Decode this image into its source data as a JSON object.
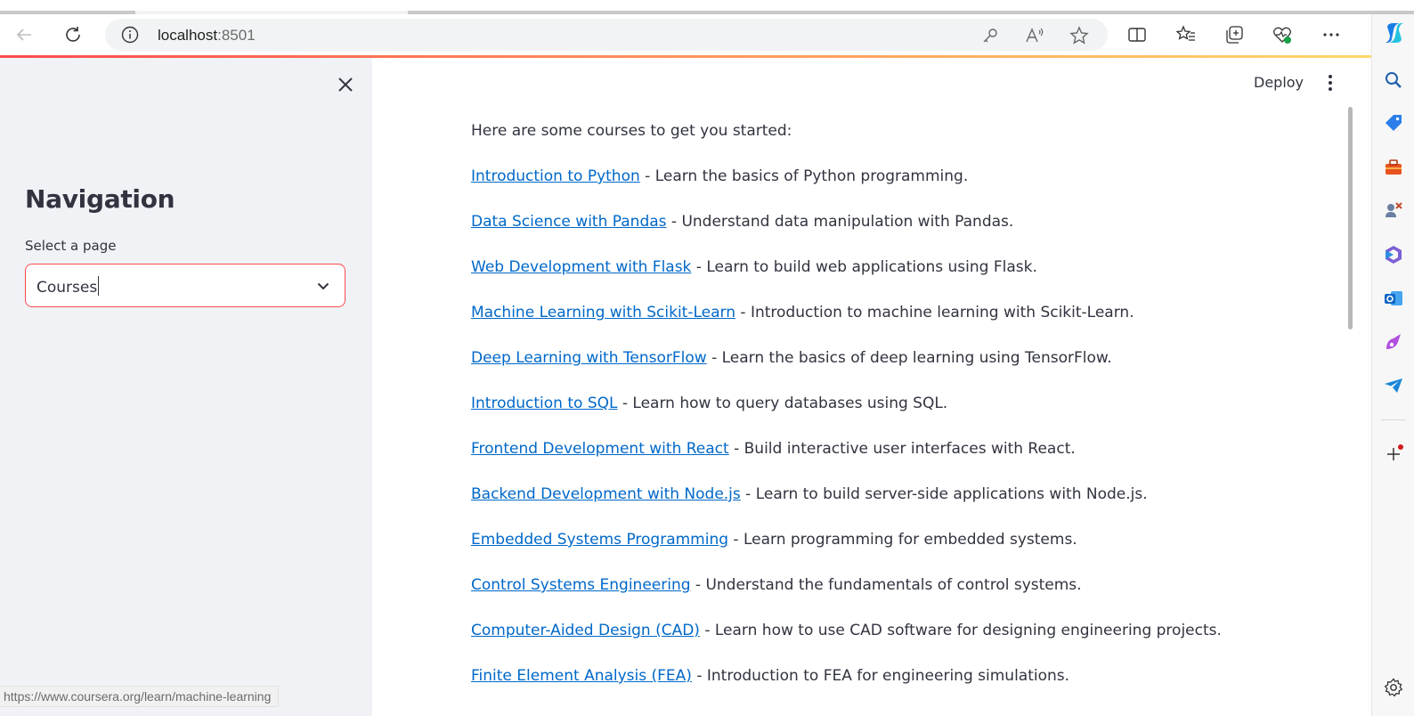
{
  "browser": {
    "url_host": "localhost",
    "url_port": ":8501",
    "status_url": "https://www.coursera.org/learn/machine-learning",
    "icons": [
      "back-icon",
      "refresh-icon",
      "info-icon",
      "key-icon",
      "read-aloud-icon",
      "favorite-star-icon",
      "split-screen-icon",
      "favorites-icon",
      "collections-icon",
      "browser-essentials-icon",
      "more-icon",
      "copilot-icon"
    ],
    "edge_icons": [
      "search-icon",
      "shopping-tag-icon",
      "tools-icon",
      "games-icon",
      "microsoft365-icon",
      "outlook-icon",
      "designer-icon",
      "telegram-icon",
      "add-icon",
      "settings-icon"
    ]
  },
  "app": {
    "header": {
      "deploy_label": "Deploy"
    },
    "sidebar": {
      "title": "Navigation",
      "select_label": "Select a page",
      "select_value": "Courses"
    },
    "main": {
      "intro": "Here are some courses to get you started:",
      "courses": [
        {
          "title": "Introduction to Python",
          "desc": " - Learn the basics of Python programming."
        },
        {
          "title": "Data Science with Pandas",
          "desc": " - Understand data manipulation with Pandas."
        },
        {
          "title": "Web Development with Flask",
          "desc": " - Learn to build web applications using Flask."
        },
        {
          "title": "Machine Learning with Scikit-Learn",
          "desc": " - Introduction to machine learning with Scikit-Learn."
        },
        {
          "title": "Deep Learning with TensorFlow",
          "desc": " - Learn the basics of deep learning using TensorFlow."
        },
        {
          "title": "Introduction to SQL",
          "desc": " - Learn how to query databases using SQL."
        },
        {
          "title": "Frontend Development with React",
          "desc": " - Build interactive user interfaces with React."
        },
        {
          "title": "Backend Development with Node.js",
          "desc": " - Learn to build server-side applications with Node.js."
        },
        {
          "title": "Embedded Systems Programming",
          "desc": " - Learn programming for embedded systems."
        },
        {
          "title": "Control Systems Engineering",
          "desc": " - Understand the fundamentals of control systems."
        },
        {
          "title": "Computer-Aided Design (CAD)",
          "desc": " - Learn how to use CAD software for designing engineering projects."
        },
        {
          "title": "Finite Element Analysis (FEA)",
          "desc": " - Introduction to FEA for engineering simulations."
        }
      ]
    }
  },
  "colors": {
    "accent": "#ff4b4b",
    "link": "#0068c9",
    "text": "#31333f",
    "sidebar_bg": "#f0f2f6"
  }
}
